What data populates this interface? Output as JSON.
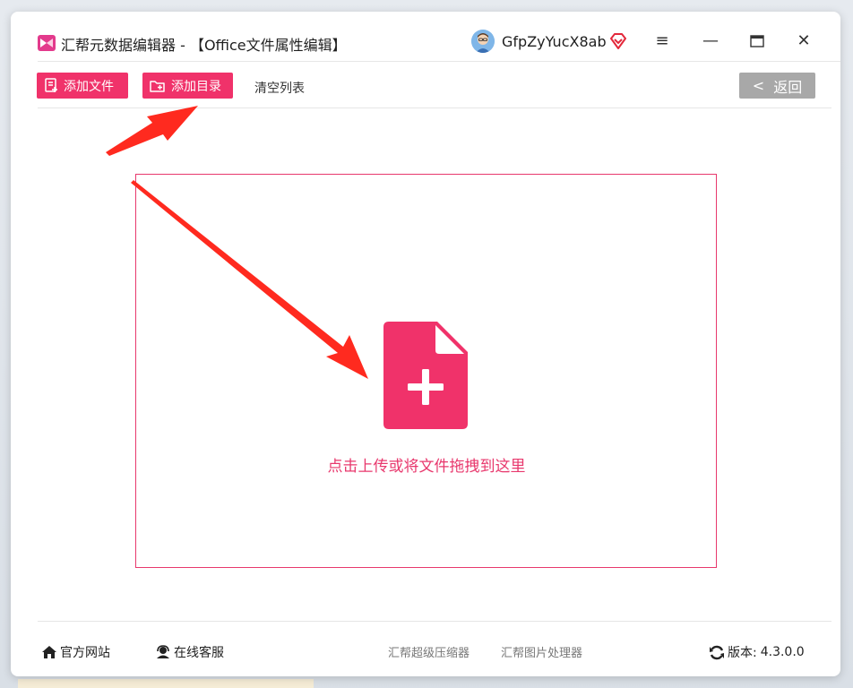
{
  "window": {
    "title": "汇帮元数据编辑器 - 【Office文件属性编辑】",
    "username": "GfpZyYucX8ab",
    "controls": {
      "menu": "≡",
      "minimize": "—",
      "maximize": "▭",
      "close": "✕"
    }
  },
  "toolbar": {
    "add_file_label": "添加文件",
    "add_dir_label": "添加目录",
    "clear_list_label": "清空列表",
    "back_chevron": "<",
    "back_label": "返回"
  },
  "dropzone": {
    "hint": "点击上传或将文件拖拽到这里"
  },
  "footer": {
    "official_site": "官方网站",
    "online_service": "在线客服",
    "compressor": "汇帮超级压缩器",
    "image_processor": "汇帮图片处理器",
    "version_label": "版本:",
    "version_value": "4.3.0.0"
  },
  "colors": {
    "accent": "#f0326a",
    "dropzone_border": "#e8386d",
    "back_button": "#a8a8a8",
    "arrow": "#ff2a1f",
    "app_logo": "#e33a8c"
  },
  "icons": [
    "app-logo-icon",
    "avatar-icon",
    "vip-diamond-icon",
    "menu-icon",
    "minimize-icon",
    "maximize-icon",
    "close-icon",
    "file-add-icon",
    "folder-add-icon",
    "file-plus-icon",
    "home-icon",
    "headset-icon",
    "refresh-icon",
    "arrow-pointer-icon"
  ]
}
